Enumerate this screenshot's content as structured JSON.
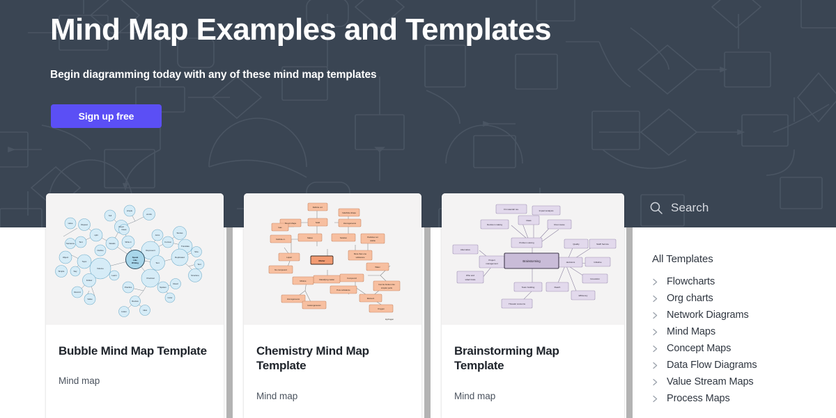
{
  "hero": {
    "title": "Mind Map Examples and Templates",
    "subtitle": "Begin diagramming today with any of these mind map templates",
    "cta_label": "Sign up free",
    "bg_color": "#3a4553",
    "cta_color": "#5b4ff5"
  },
  "search": {
    "label": "Search",
    "icon": "search-icon"
  },
  "cards": [
    {
      "title": "Bubble Mind Map Template",
      "tag": "Mind map",
      "thumb_style": "bubble",
      "node_color": "#cfe8f5",
      "center_label": "Speak Like Writing"
    },
    {
      "title": "Chemistry Mind Map Template",
      "tag": "Mind map",
      "thumb_style": "chemistry",
      "node_color": "#f6b896",
      "center_label": "Matter"
    },
    {
      "title": "Brainstorming Map Template",
      "tag": "Mind map",
      "thumb_style": "brainstorming",
      "node_color": "#ddd2e8",
      "center_label": "Brainstorming"
    }
  ],
  "sidebar": {
    "heading": "All Templates",
    "items": [
      {
        "label": "Flowcharts",
        "icon": "chevron-right-icon"
      },
      {
        "label": "Org charts",
        "icon": "chevron-right-icon"
      },
      {
        "label": "Network Diagrams",
        "icon": "chevron-right-icon"
      },
      {
        "label": "Mind Maps",
        "icon": "chevron-right-icon"
      },
      {
        "label": "Concept Maps",
        "icon": "chevron-right-icon"
      },
      {
        "label": "Data Flow Diagrams",
        "icon": "chevron-right-icon"
      },
      {
        "label": "Value Stream Maps",
        "icon": "chevron-right-icon"
      },
      {
        "label": "Process Maps",
        "icon": "chevron-right-icon"
      }
    ]
  }
}
